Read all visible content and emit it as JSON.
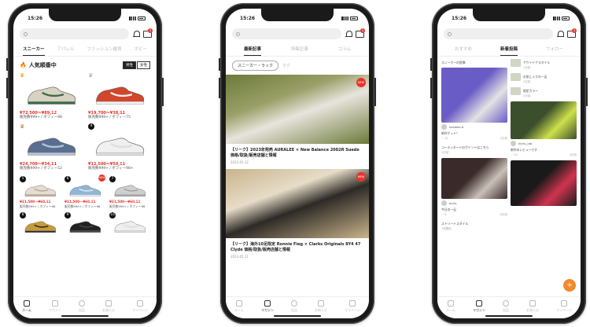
{
  "status": {
    "time": "15:26"
  },
  "search": {
    "placeholder": ""
  },
  "cart_badge": "1",
  "phone1": {
    "tabs": [
      {
        "label": "スニーカー",
        "active": true
      },
      {
        "label": "アパレル",
        "active": false
      },
      {
        "label": "ファッション雑貨",
        "active": false
      },
      {
        "label": "ホビー",
        "active": false
      }
    ],
    "section_title": "人気順番中",
    "toggle": [
      "男性",
      "女性"
    ],
    "top_products": [
      {
        "rank": "crown-gold",
        "price": "¥72,500〜¥89,12",
        "meta1": "販売数999+ / ボフィー98",
        "meta2": "",
        "shoe_colors": [
          "#d8d2c0",
          "#3d6b4a"
        ]
      },
      {
        "rank": "crown-silver",
        "price": "¥19,700〜¥38,11",
        "meta1": "販売数999+ / ボフィー75",
        "meta2": "",
        "shoe_colors": [
          "#d2462b",
          "#f2f2f2"
        ]
      },
      {
        "rank": "crown-bronze",
        "price": "¥24,700〜¥34,11",
        "meta1": "販売数999+ / ボフィー52",
        "meta2": "",
        "shoe_colors": [
          "#5a6f90",
          "#b8c2d6"
        ]
      },
      {
        "rank": "4",
        "price": "¥12,500〜¥50,11",
        "meta1": "販売数999+ / ボフィー98+",
        "meta2": "",
        "shoe_colors": [
          "#f0f0f0",
          "#dedede"
        ]
      }
    ],
    "small_products": [
      {
        "rank": "5",
        "price": "¥21,500〜¥60,11",
        "meta": "販売数999+ / ボフィー98",
        "new": false,
        "shoe_colors": [
          "#e6ddd0",
          "#b7a996"
        ]
      },
      {
        "rank": "6",
        "price": "¥21,500〜¥60,11",
        "meta": "販売数999+ / ボフィー98",
        "new": true,
        "new_label": "NEW",
        "shoe_colors": [
          "#8fb6d6",
          "#e8e8e8"
        ]
      },
      {
        "rank": "7",
        "price": "¥21,500〜¥60,11",
        "meta": "販売数999+ / ボフィー98",
        "new": false,
        "shoe_colors": [
          "#cfcfcf",
          "#9ea3a8"
        ]
      },
      {
        "rank": "8",
        "price": "",
        "meta": "",
        "new": false,
        "shoe_colors": [
          "#c99a3a",
          "#2a2a2a"
        ]
      },
      {
        "rank": "9",
        "price": "",
        "meta": "",
        "new": false,
        "shoe_colors": [
          "#222222",
          "#444444"
        ]
      },
      {
        "rank": "10",
        "price": "",
        "meta": "",
        "new": false,
        "shoe_colors": [
          "#eeeeee",
          "#dcdcdc"
        ]
      }
    ]
  },
  "phone2": {
    "tabs": [
      {
        "label": "最新記事",
        "active": true
      },
      {
        "label": "特集記事",
        "active": false
      },
      {
        "label": "コラム",
        "active": false
      }
    ],
    "pills": [
      {
        "label": "スニーカー・ラック",
        "active": true
      },
      {
        "label": "タグ",
        "active": false
      }
    ],
    "articles": [
      {
        "title": "【リーク】2023年発売 AURALEE × New Balance 2002R Suede 価格/取扱/販売店舗と情報",
        "meta": "2023.05.12",
        "badge": "NEW",
        "colors": [
          "#6b7a3a",
          "#e8e4dd",
          "#9aa068"
        ]
      },
      {
        "title": "【リーク】海外10足限定 Ronnie Fieg × Clarks Originals 8Y4 47 Clyde 価格/取扱/販売店舗と情報",
        "meta": "2023.05.11",
        "badge": "NEW",
        "colors": [
          "#c9b48b",
          "#2d2a26",
          "#e6dcc8"
        ]
      }
    ]
  },
  "phone3": {
    "tabs": [
      {
        "label": "おすすめ",
        "active": false
      },
      {
        "label": "新着投稿",
        "active": true
      },
      {
        "label": "フォロー",
        "active": false
      }
    ],
    "left_col": [
      {
        "type": "text",
        "text": "スニーカーの投稿"
      },
      {
        "type": "image",
        "h": 70,
        "colors": [
          "#6a5cc7",
          "#e3e3e3"
        ],
        "user": "sneaker.d",
        "text": "新作ゲット！",
        "likes": "12",
        "date": "3日前"
      },
      {
        "type": "text-small",
        "text": "コーディネートのポイントはこちら",
        "date": "5日前"
      },
      {
        "type": "image",
        "h": 52,
        "colors": [
          "#3a2a2a",
          "#c9c1b8"
        ],
        "user": "kicks",
        "text": "今日の一足",
        "likes": "8",
        "date": "6日前"
      },
      {
        "type": "text-small",
        "text": "ストリートスタイル",
        "date": "1週間前"
      }
    ],
    "right_col": [
      {
        "type": "row",
        "text": "アウトドアスタイル",
        "date": "1日前"
      },
      {
        "type": "row",
        "text": "お気に入りの一足",
        "date": "2日前"
      },
      {
        "type": "row",
        "text": "限定カラー",
        "date": "2日前"
      },
      {
        "type": "image",
        "h": 48,
        "colors": [
          "#3c4f2c",
          "#cde04a"
        ],
        "user": "kicks_lab",
        "text": "新作のレビューです",
        "likes": "24",
        "date": "4日前"
      },
      {
        "type": "image",
        "h": 58,
        "colors": [
          "#1a1a1a",
          "#d0344e"
        ],
        "user": "",
        "text": "",
        "likes": "",
        "date": ""
      }
    ]
  },
  "bottom_nav": [
    {
      "label": "ホーム",
      "icon": "home-icon"
    },
    {
      "label": "マガジン",
      "icon": "magazine-icon"
    },
    {
      "label": "出品",
      "icon": "plus-circle-icon"
    },
    {
      "label": "お知らせ",
      "icon": "notification-icon"
    },
    {
      "label": "マイページ",
      "icon": "user-icon"
    }
  ]
}
